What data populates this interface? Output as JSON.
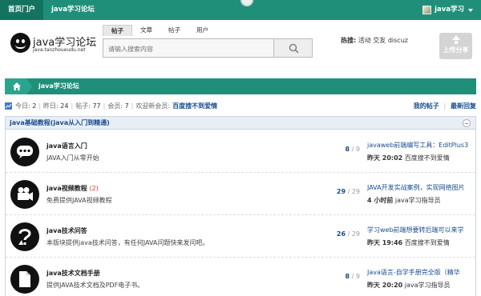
{
  "topbar": {
    "home_label": "首页门户",
    "forum_label": "java学习论坛",
    "user_label": "java学习"
  },
  "header": {
    "logo_title": "java学习论坛",
    "logo_subtitle": "java.tanzhoueudu.net",
    "search_tabs": [
      "帖子",
      "文章",
      "帖子",
      "用户"
    ],
    "search_placeholder": "请输入搜索内容",
    "hot_label": "热搜:",
    "hot_items": "活动 交友 discuz",
    "upload_label": "上传分享"
  },
  "breadcrumb": {
    "current": "java学习论坛"
  },
  "stats": {
    "today_label": "今日:",
    "today_value": "2",
    "yesterday_label": "昨日:",
    "yesterday_value": "24",
    "posts_label": "帖子:",
    "posts_value": "77",
    "members_label": "会员:",
    "members_value": "7",
    "welcome_label": "欢迎新会员:",
    "new_member": "百度搜不到爱情"
  },
  "quick_links": {
    "my_posts": "我的帖子",
    "latest_replies": "最新回复"
  },
  "section": {
    "title": "java基础教程(java从入门到精通)"
  },
  "forums": [
    {
      "name": "java语言入门",
      "today": "",
      "desc": "JAVA入门从零开始",
      "threads": "8",
      "posts": "9",
      "icon": "chat-bubble-icon",
      "last_title": "javaweb前端编写工具：EditPlus3",
      "last_time": "昨天 20:02",
      "last_user": "百度搜不到爱情"
    },
    {
      "name": "java视频教程",
      "today": "(2)",
      "desc": "免费提供JAVA视频教程",
      "threads": "29",
      "posts": "29",
      "icon": "video-camera-icon",
      "last_title": "JAVA开发实战案例，实现网络图片",
      "last_time": "4 小时前",
      "last_user": "java学习指导员"
    },
    {
      "name": "java技术问答",
      "today": "",
      "desc": "本版块提供java技术问答，有任何JAVA问题快来发问吧。",
      "threads": "26",
      "posts": "29",
      "icon": "question-icon",
      "last_title": "学习web前端想要转后端可以来学",
      "last_time": "昨天 19:46",
      "last_user": "百度搜不到爱情"
    },
    {
      "name": "java技术文档手册",
      "today": "",
      "desc": "提供JAVA技术文档及PDF电子书。",
      "threads": "8",
      "posts": "9",
      "icon": "document-icon",
      "last_title": "Java语言-自学手册完全版（精华",
      "last_time": "昨天 20:20",
      "last_user": "java学习指导员"
    }
  ],
  "colors": {
    "brand_green": "#1f8f7a",
    "link_blue": "#1a4d8f"
  }
}
